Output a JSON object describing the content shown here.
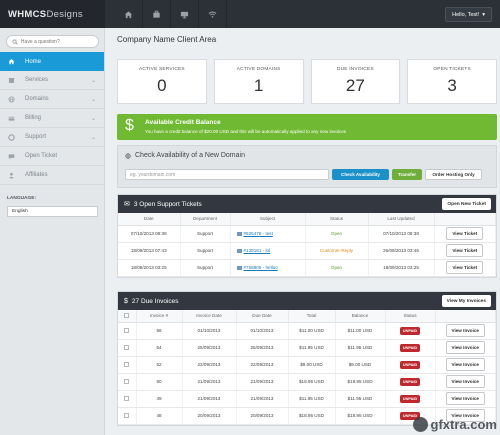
{
  "header": {
    "logo_bold": "WHMCS",
    "logo_light": "Designs",
    "hello": "Hello, Test!"
  },
  "sidebar": {
    "search_placeholder": "Have a question?",
    "items": [
      {
        "label": "Home",
        "icon": "home-icon"
      },
      {
        "label": "Services",
        "icon": "box-icon"
      },
      {
        "label": "Domains",
        "icon": "globe-icon"
      },
      {
        "label": "Billing",
        "icon": "card-icon"
      },
      {
        "label": "Support",
        "icon": "support-icon"
      },
      {
        "label": "Open Ticket",
        "icon": "ticket-icon"
      },
      {
        "label": "Affiliates",
        "icon": "affiliates-icon"
      }
    ],
    "language_label": "LANGUAGE:",
    "language_value": "English"
  },
  "main": {
    "title": "Company Name Client Area",
    "stats": [
      {
        "label": "ACTIVE SERVICES",
        "value": "0"
      },
      {
        "label": "ACTIVE DOMAINS",
        "value": "1"
      },
      {
        "label": "DUE INVOICES",
        "value": "27"
      },
      {
        "label": "OPEN TICKETS",
        "value": "3"
      }
    ],
    "credit": {
      "title": "Available Credit Balance",
      "text": "You have a credit balance of $20.00 USD and this will be automatically applied to any new invoices"
    },
    "domain": {
      "title": "Check Availability of a New Domain",
      "placeholder": "eg. yourdomain.com",
      "check_btn": "Check Availability",
      "transfer_btn": "Transfer",
      "hosting_btn": "Order Hosting Only"
    },
    "tickets": {
      "title": "3 Open Support Tickets",
      "button": "Open New Ticket",
      "columns": [
        "Date",
        "Department",
        "Subject",
        "Status",
        "Last Updated",
        ""
      ],
      "rows": [
        {
          "date": "07/10/2013 08:38",
          "dept": "Support",
          "subject": "#625478 - test",
          "status": "Open",
          "updated": "07/10/2013 08:38",
          "action": "View Ticket"
        },
        {
          "date": "18/09/2013 07:43",
          "dept": "Support",
          "subject": "#139181 - lol",
          "status": "Customer-Reply",
          "updated": "26/09/2013 03:46",
          "action": "View Ticket"
        },
        {
          "date": "18/09/2013 03:25",
          "dept": "Support",
          "subject": "#758805 - helloo",
          "status": "Open",
          "updated": "18/09/2013 03:25",
          "action": "View Ticket"
        }
      ]
    },
    "invoices": {
      "title": "27 Due Invoices",
      "button": "View My Invoices",
      "columns": [
        "",
        "Invoice #",
        "Invoice Date",
        "Due Date",
        "Total",
        "Balance",
        "Status",
        ""
      ],
      "rows": [
        {
          "num": "56",
          "inv_date": "01/10/2013",
          "due": "01/10/2013",
          "total": "$11.00 USD",
          "balance": "$11.00 USD",
          "status": "UNPAID",
          "action": "View Invoice"
        },
        {
          "num": "54",
          "inv_date": "25/09/2013",
          "due": "25/09/2013",
          "total": "$11.95 USD",
          "balance": "$11.95 USD",
          "status": "UNPAID",
          "action": "View Invoice"
        },
        {
          "num": "52",
          "inv_date": "22/09/2013",
          "due": "22/09/2013",
          "total": "$9.00 USD",
          "balance": "$9.00 USD",
          "status": "UNPAID",
          "action": "View Invoice"
        },
        {
          "num": "50",
          "inv_date": "21/09/2013",
          "due": "21/09/2013",
          "total": "$18.95 USD",
          "balance": "$18.95 USD",
          "status": "UNPAID",
          "action": "View Invoice"
        },
        {
          "num": "49",
          "inv_date": "21/09/2013",
          "due": "21/09/2013",
          "total": "$11.95 USD",
          "balance": "$11.95 USD",
          "status": "UNPAID",
          "action": "View Invoice"
        },
        {
          "num": "48",
          "inv_date": "20/09/2013",
          "due": "20/09/2013",
          "total": "$18.95 USD",
          "balance": "$18.95 USD",
          "status": "UNPAID",
          "action": "View Invoice"
        }
      ]
    }
  },
  "watermark": "gfxtra.com",
  "colors": {
    "accent": "#1b9ad8",
    "credit": "#70b933",
    "unpaid": "#c0282d",
    "topbar": "#2c3138"
  }
}
